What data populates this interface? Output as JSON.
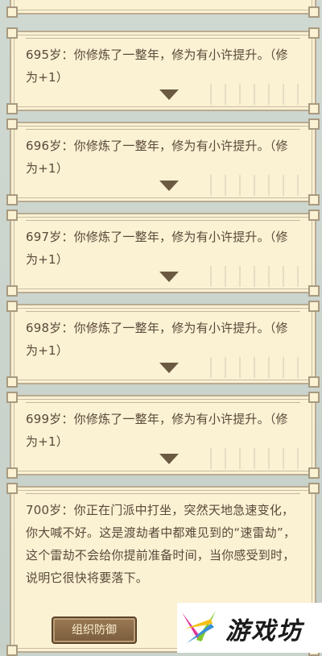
{
  "entries": [
    {
      "text": "695岁：你修炼了一整年，修为有小许提升。（修为+1）"
    },
    {
      "text": "696岁：你修炼了一整年，修为有小许提升。（修为+1）"
    },
    {
      "text": "697岁：你修炼了一整年，修为有小许提升。（修为+1）"
    },
    {
      "text": "698岁：你修炼了一整年，修为有小许提升。（修为+1）"
    },
    {
      "text": "699岁：你修炼了一整年，修为有小许提升。（修为+1）"
    },
    {
      "text": "700岁：你正在门派中打坐，突然天地急速变化，你大喊不好。这是渡劫者中都难见到的“速雷劫”，这个雷劫不会给你提前准备时间，当你感受到时，说明它很快将要落下。"
    }
  ],
  "action_button": "组织防御",
  "watermark_text": "游戏坊"
}
